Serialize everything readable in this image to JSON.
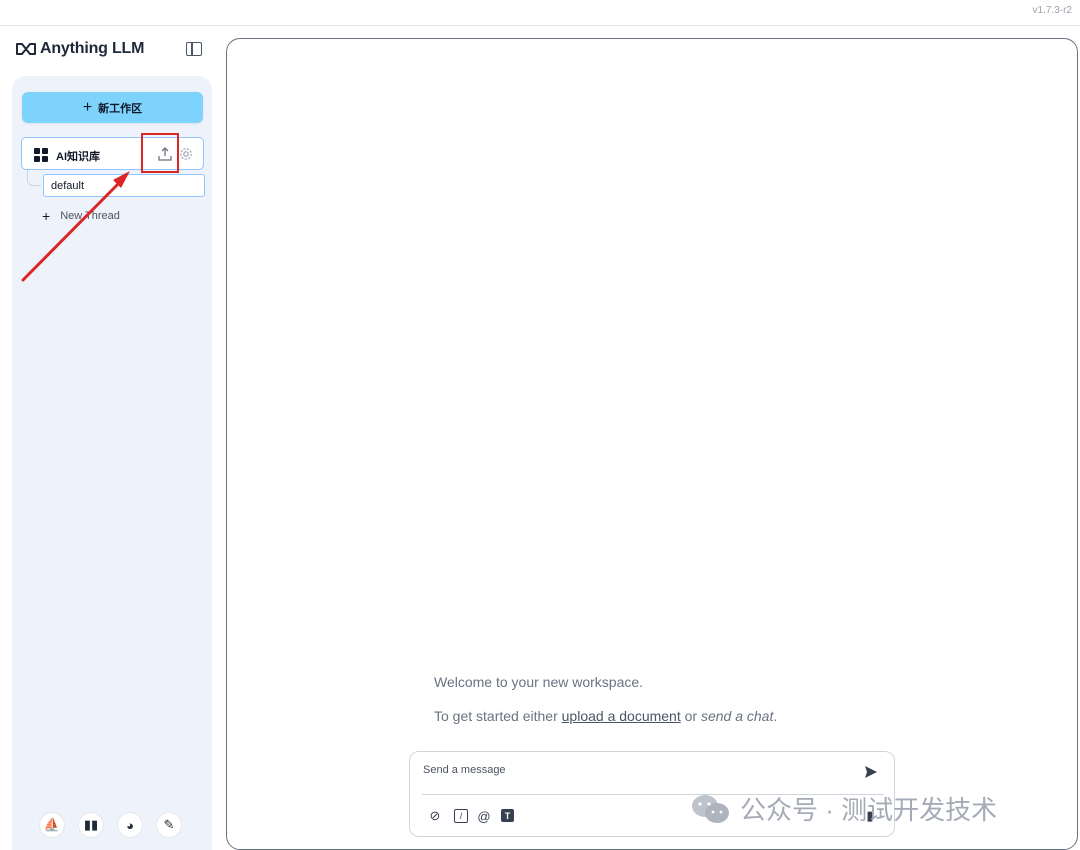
{
  "app": {
    "version": "v1.7.3-r2",
    "name": "Anything LLM"
  },
  "sidebar": {
    "new_workspace_label": "新工作区",
    "workspace": {
      "name": "AI知识库"
    },
    "threads": [
      {
        "label": "default"
      }
    ],
    "new_thread_label": "New Thread",
    "footer_icons": [
      "community-hub-icon",
      "docs-icon",
      "discord-icon",
      "settings-wrench-icon"
    ]
  },
  "main": {
    "welcome": "Welcome to your new workspace.",
    "get_started_prefix": "To get started either ",
    "upload_link": "upload a document",
    "or_text": " or ",
    "send_chat": "send a chat",
    "period": "."
  },
  "composer": {
    "placeholder": "Send a message",
    "tools": [
      "attach-icon",
      "slash-command-icon",
      "at-mention-icon",
      "text-size-icon",
      "microphone-icon"
    ],
    "at_glyph": "@",
    "t_glyph": "T",
    "slash_glyph": "/"
  },
  "watermark": {
    "text": "公众号 · 测试开发技术"
  },
  "colors": {
    "accent": "#7dd3fc",
    "highlight": "#dc2626",
    "panel": "#eef2fa"
  }
}
